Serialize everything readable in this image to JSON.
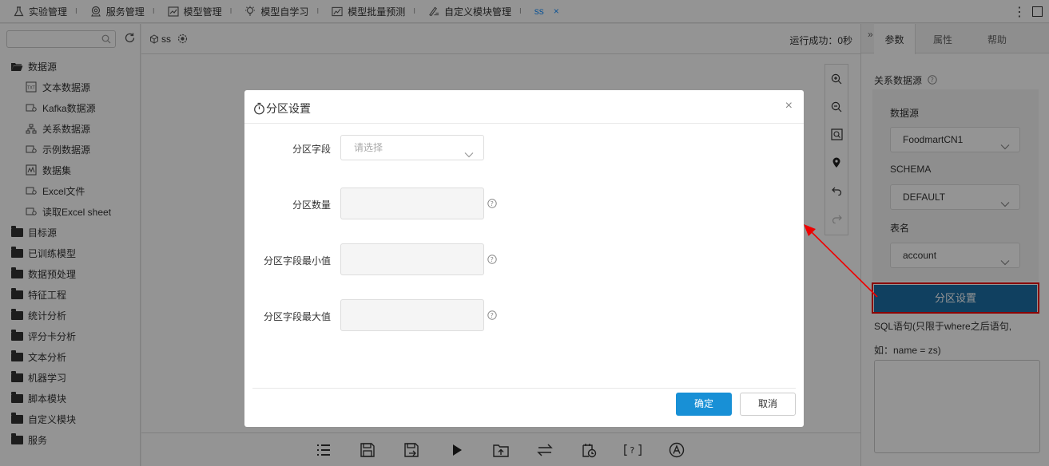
{
  "nav": {
    "tabs": [
      {
        "label": "实验管理",
        "icon": "flask-icon"
      },
      {
        "label": "服务管理",
        "icon": "service-icon"
      },
      {
        "label": "模型管理",
        "icon": "chart-icon"
      },
      {
        "label": "模型自学习",
        "icon": "bulb-icon"
      },
      {
        "label": "模型批量预测",
        "icon": "trend-icon"
      },
      {
        "label": "自定义模块管理",
        "icon": "edit-icon"
      }
    ],
    "active_tab": "ss",
    "separator": "I",
    "close": "×"
  },
  "sidebar": {
    "search_placeholder": "",
    "tree": [
      {
        "label": "数据源",
        "type": "folder-open"
      },
      {
        "label": "文本数据源",
        "type": "child"
      },
      {
        "label": "Kafka数据源",
        "type": "child"
      },
      {
        "label": "关系数据源",
        "type": "child"
      },
      {
        "label": "示例数据源",
        "type": "child"
      },
      {
        "label": "数据集",
        "type": "child"
      },
      {
        "label": "Excel文件",
        "type": "child"
      },
      {
        "label": "读取Excel sheet",
        "type": "child"
      },
      {
        "label": "目标源",
        "type": "folder"
      },
      {
        "label": "已训练模型",
        "type": "folder"
      },
      {
        "label": "数据预处理",
        "type": "folder"
      },
      {
        "label": "特征工程",
        "type": "folder"
      },
      {
        "label": "统计分析",
        "type": "folder"
      },
      {
        "label": "评分卡分析",
        "type": "folder"
      },
      {
        "label": "文本分析",
        "type": "folder"
      },
      {
        "label": "机器学习",
        "type": "folder"
      },
      {
        "label": "脚本模块",
        "type": "folder"
      },
      {
        "label": "自定义模块",
        "type": "folder"
      },
      {
        "label": "服务",
        "type": "folder"
      }
    ]
  },
  "canvas": {
    "experiment_name": "ss",
    "run_status": "运行成功：0秒"
  },
  "right_panel": {
    "tabs": [
      "参数",
      "属性",
      "帮助"
    ],
    "section_title": "关系数据源",
    "datasource_label": "数据源",
    "datasource_value": "FoodmartCN1",
    "schema_label": "SCHEMA",
    "schema_value": "DEFAULT",
    "table_label": "表名",
    "table_value": "account",
    "partition_button": "分区设置",
    "sql_hint_line1": "SQL语句(只限于where之后语句,",
    "sql_hint_line2": "如：name = zs)"
  },
  "modal": {
    "title": "分区设置",
    "fields": {
      "partition_field_label": "分区字段",
      "partition_field_placeholder": "请选择",
      "partition_count_label": "分区数量",
      "min_label": "分区字段最小值",
      "max_label": "分区字段最大值"
    },
    "ok": "确定",
    "cancel": "取消",
    "close": "×"
  },
  "colors": {
    "primary": "#1890d6",
    "partition_button": "#1d6fa5",
    "highlight": "#ee0000",
    "overlay": "rgba(0,0,0,0.42)"
  }
}
